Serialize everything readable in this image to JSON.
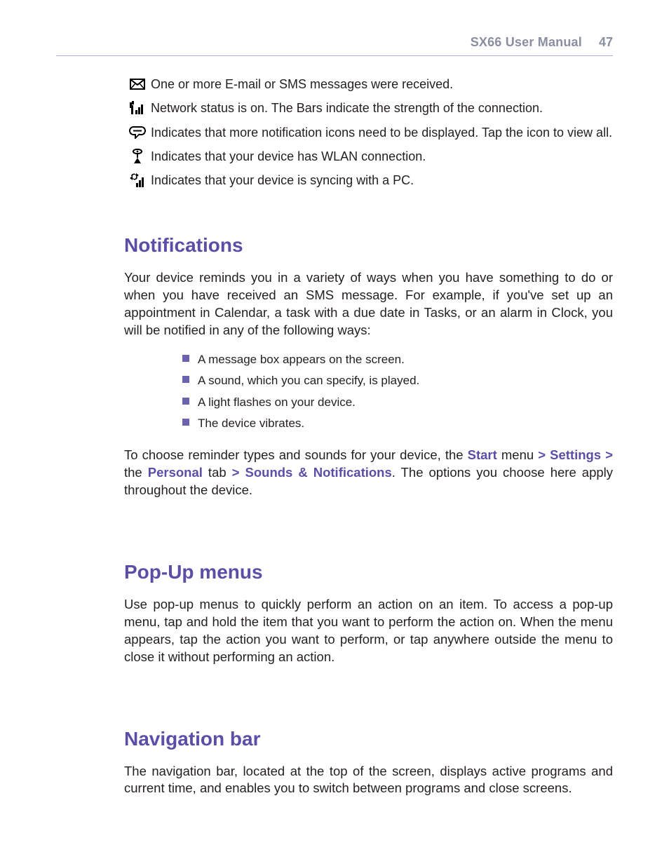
{
  "header": {
    "title": "SX66 User Manual",
    "page": "47"
  },
  "icons": [
    {
      "name": "mail-icon",
      "text": "One or more E-mail or SMS messages were received."
    },
    {
      "name": "signal-icon",
      "text": "Network status is on. The Bars indicate the strength of the connection."
    },
    {
      "name": "more-notifications-icon",
      "text": "Indicates that more notification icons need to be displayed. Tap the icon to view all."
    },
    {
      "name": "wlan-icon",
      "text": "Indicates that your device has WLAN connection."
    },
    {
      "name": "sync-icon",
      "text": "Indicates that your device is syncing with a PC."
    }
  ],
  "sections": {
    "notifications": {
      "heading": "Notifications",
      "p1": "Your device reminds you in a variety of ways when you have something to do or when you have received an SMS message. For example, if you've set up an appointment in Calendar, a task with a due date in Tasks, or an alarm in Clock, you will be notified in any of the following ways:",
      "bullets": [
        "A message box appears on the screen.",
        "A sound, which you can specify, is played.",
        "A light flashes on your device.",
        "The device vibrates."
      ],
      "p2_parts": {
        "pre": "To choose reminder types and sounds for your device, the ",
        "start": "Start",
        "mid1": " menu ",
        "path1": "> Settings >",
        "mid2": " the ",
        "personal": "Personal",
        "mid3": " tab ",
        "path2": "> Sounds & Notifications",
        "post": ". The options you choose here apply throughout the device."
      }
    },
    "popup": {
      "heading": "Pop-Up menus",
      "p1": "Use pop-up menus to quickly perform an action on an item. To access a pop-up menu, tap and hold the item that you want to perform the action on. When the menu appears, tap the action you want to perform, or tap anywhere outside the menu to close it without performing an action."
    },
    "navbar": {
      "heading": "Navigation bar",
      "p1": "The navigation bar, located at the top of the screen, displays active programs and current time, and enables you to switch between programs and close screens."
    }
  }
}
